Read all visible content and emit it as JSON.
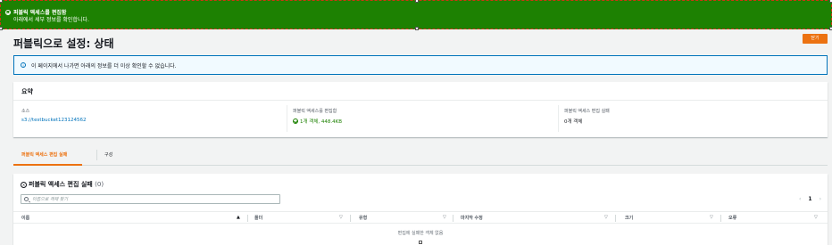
{
  "flash": {
    "title": "퍼블릭 액세스를 편집함",
    "message": "아래에서 세부 정보를 확인합니다.",
    "color": "#1d8102",
    "icon": "check-circle-icon"
  },
  "page": {
    "title": "퍼블릭으로 설정: 상태",
    "close_label": "닫기"
  },
  "info": {
    "icon": "info-icon",
    "text": "이 페이지에서 나가면 아래의 정보를 더 이상 확인할 수 없습니다."
  },
  "summary": {
    "header": "요약",
    "columns": [
      {
        "label": "소스",
        "value": "s3://testbucket123124562"
      },
      {
        "label": "퍼블릭 액세스를 편집함",
        "value": "1개 객체, 448.4KB"
      },
      {
        "label": "퍼블릭 액세스 편집 실패",
        "value": "0개 객체"
      }
    ]
  },
  "tabs": [
    {
      "label": "퍼블릭 액세스 편집 실패",
      "active": true
    },
    {
      "label": "구성",
      "active": false
    }
  ],
  "failures": {
    "title": "퍼블릭 액세스 편집 실패",
    "count": "(0)",
    "search_placeholder": "이름으로 객체 찾기",
    "page": "1",
    "columns": [
      "이름",
      "폴더",
      "유형",
      "마지막 수정",
      "크기",
      "오류"
    ],
    "empty_text": "편집에 실패한 객체 없음"
  },
  "colors": {
    "accent": "#ec7211",
    "link": "#0073bb",
    "success": "#1d8102"
  }
}
